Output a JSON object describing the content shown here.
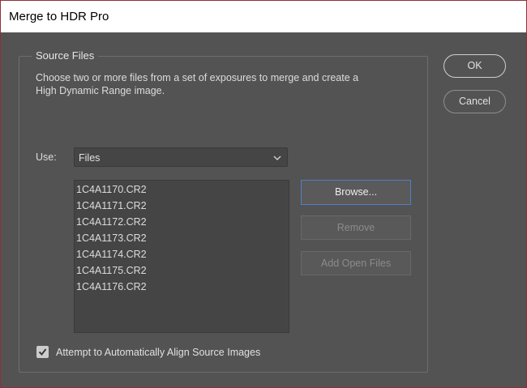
{
  "window": {
    "title": "Merge to HDR Pro"
  },
  "source_files": {
    "legend": "Source Files",
    "description": "Choose two or more files from a set of exposures to merge and create a High Dynamic Range image.",
    "use_label": "Use:",
    "use_selected": "Files",
    "files": [
      "1C4A1170.CR2",
      "1C4A1171.CR2",
      "1C4A1172.CR2",
      "1C4A1173.CR2",
      "1C4A1174.CR2",
      "1C4A1175.CR2",
      "1C4A1176.CR2"
    ],
    "browse_label": "Browse...",
    "remove_label": "Remove",
    "add_open_label": "Add Open Files",
    "align_label": "Attempt to Automatically Align Source Images",
    "align_checked": true
  },
  "actions": {
    "ok_label": "OK",
    "cancel_label": "Cancel"
  },
  "colors": {
    "background": "#535353",
    "focus_blue": "#4f7fc9",
    "disabled_text": "#8b8b8b"
  }
}
